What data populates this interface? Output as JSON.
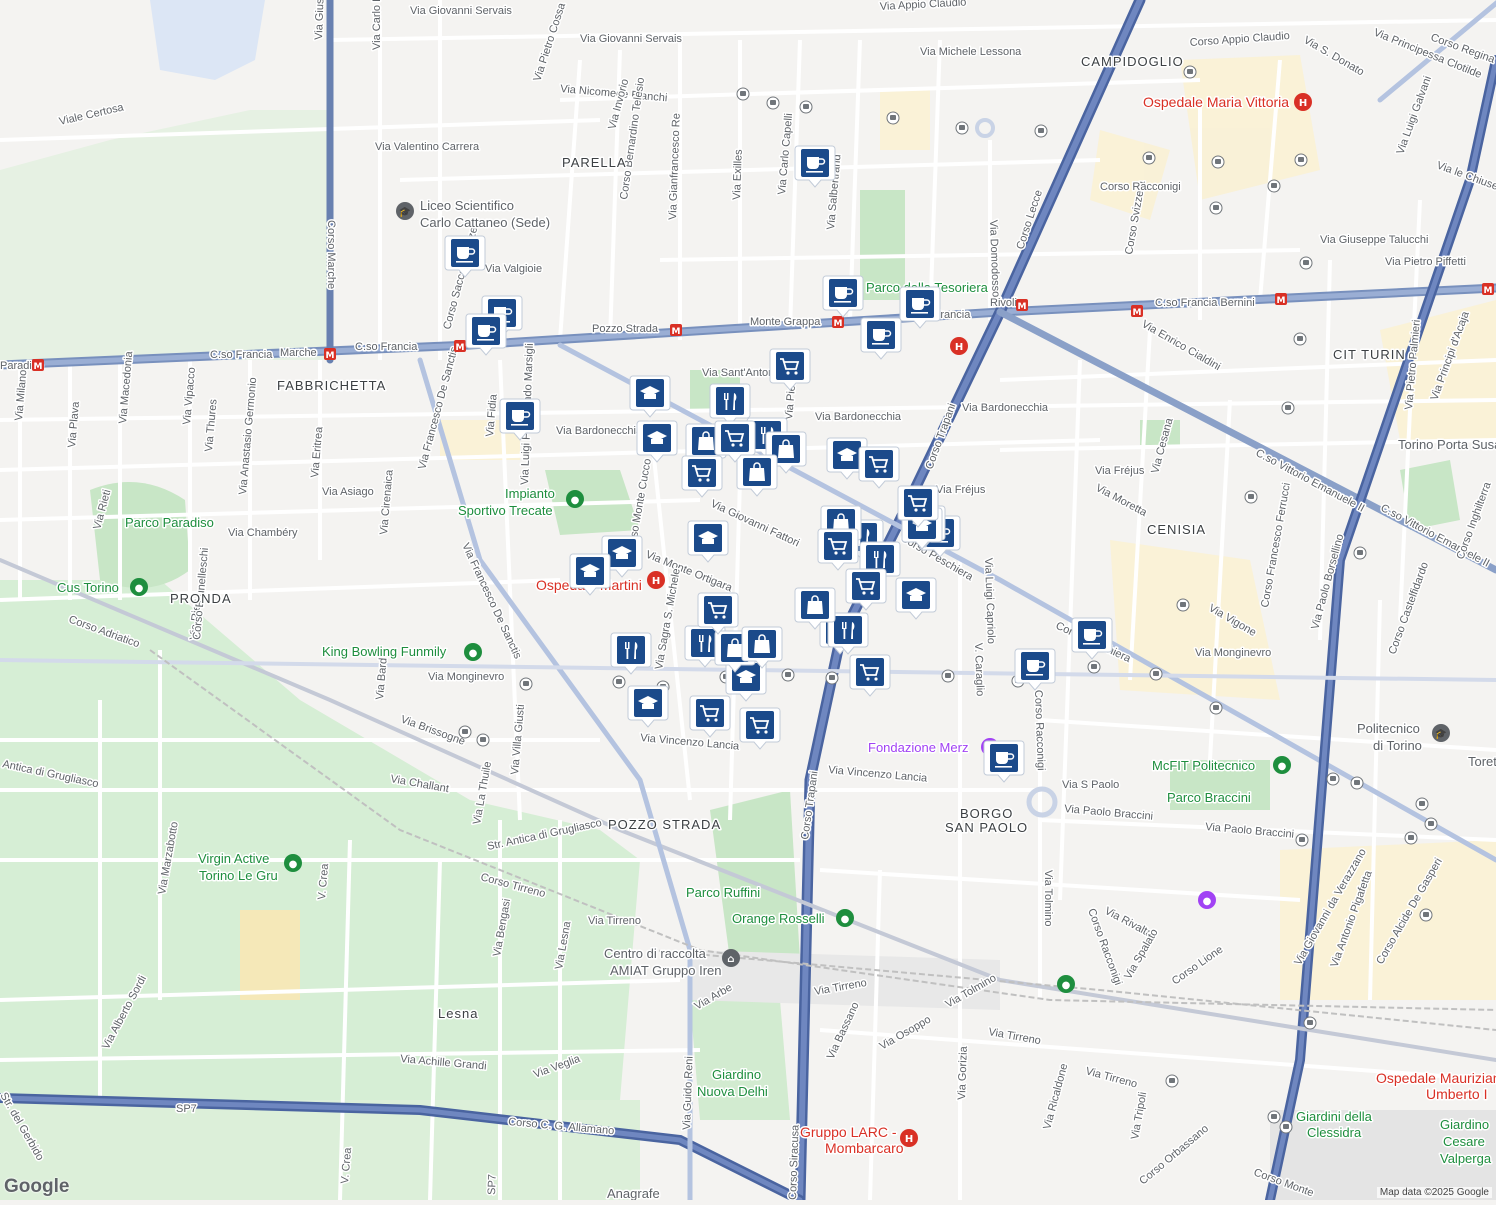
{
  "map": {
    "credit": "Map data ©2025 Google",
    "logo": "Google",
    "colors": {
      "background": "#f4f3f1",
      "park": "#cdeccf",
      "major_road": "#8aa0c8",
      "metro_road": "#3f5f99",
      "minor_road": "#ffffff",
      "marker": "#1b4a8a"
    },
    "areas": [
      {
        "id": "campidoglio",
        "text": "CAMPIDOGLIO"
      },
      {
        "id": "parella",
        "text": "PARELLA"
      },
      {
        "id": "fabbrichetta",
        "text": "FABBRICHETTA"
      },
      {
        "id": "cit-turin",
        "text": "CIT TURIN"
      },
      {
        "id": "cenisia",
        "text": "CENISIA"
      },
      {
        "id": "pronda",
        "text": "PRONDA"
      },
      {
        "id": "pozzo-strada",
        "text": "POZZO STRADA"
      },
      {
        "id": "borgo",
        "text": "BORGO"
      },
      {
        "id": "san-paolo",
        "text": "SAN PAOLO"
      },
      {
        "id": "lesna",
        "text": "Lesna"
      }
    ],
    "streets": [
      {
        "text": "Corso Appio Claudio"
      },
      {
        "text": "Via Appio Claudio"
      },
      {
        "text": "Via Giovanni Servais"
      },
      {
        "text": "Via Giovanni Servais"
      },
      {
        "text": "Via Michele Lessona"
      },
      {
        "text": "Via Nicomede Bianchi"
      },
      {
        "text": "Viale Certosa"
      },
      {
        "text": "Via Valentino Carrera"
      },
      {
        "text": "Via Pietro Cossa"
      },
      {
        "text": "Via Carlo Bianco"
      },
      {
        "text": "Via Invorio"
      },
      {
        "text": "Corso Bernardino Telesio"
      },
      {
        "text": "Via Gianfrancesco Re"
      },
      {
        "text": "Via Exilles"
      },
      {
        "text": "Via Carlo Capelli"
      },
      {
        "text": "Via Salbertrand"
      },
      {
        "text": "Via Domodossola"
      },
      {
        "text": "Corso Lecce"
      },
      {
        "text": "Corso Svizzera"
      },
      {
        "text": "Corso Marche"
      },
      {
        "text": "Via Valgioie"
      },
      {
        "text": "C.so Francia"
      },
      {
        "text": "C.so Francia"
      },
      {
        "text": "C.so Francia"
      },
      {
        "text": "C.so Francia Bernini"
      },
      {
        "text": "Pozzo Strada"
      },
      {
        "text": "Monte Grappa"
      },
      {
        "text": "Rivoli"
      },
      {
        "text": "Marche"
      },
      {
        "text": "Paradiso"
      },
      {
        "text": "Via Sant'Antonio"
      },
      {
        "text": "Via Bardonecchia"
      },
      {
        "text": "Via Bardonecchia"
      },
      {
        "text": "Via Bardonecchia"
      },
      {
        "text": "Via Asiago"
      },
      {
        "text": "Via Chambéry"
      },
      {
        "text": "Via Fréjus"
      },
      {
        "text": "Via Fréjus"
      },
      {
        "text": "Via Moretta"
      },
      {
        "text": "Via Giovanni Fattori"
      },
      {
        "text": "Via Monte Ortigara"
      },
      {
        "text": "Corso Peschiera"
      },
      {
        "text": "Corso Peschiera"
      },
      {
        "text": "Via Monginevro"
      },
      {
        "text": "Via Monginevro"
      },
      {
        "text": "Via Brissogne"
      },
      {
        "text": "Via Challant"
      },
      {
        "text": "Via Vincenzo Lancia"
      },
      {
        "text": "Via Vincenzo Lancia"
      },
      {
        "text": "Via Paolo Braccini"
      },
      {
        "text": "Via Paolo Braccini"
      },
      {
        "text": "Via S Paolo"
      },
      {
        "text": "Str. Antica di Grugliasco"
      },
      {
        "text": "Antica di Grugliasco"
      },
      {
        "text": "Corso Tirreno"
      },
      {
        "text": "Via Tirreno"
      },
      {
        "text": "Via Tirreno"
      },
      {
        "text": "Via Tirreno"
      },
      {
        "text": "Via Tirreno"
      },
      {
        "text": "Corso Adriatico"
      },
      {
        "text": "Corso C. G. Allamano"
      },
      {
        "text": "Via Achille Grandi"
      },
      {
        "text": "Via Veglia"
      },
      {
        "text": "Via Arbe"
      },
      {
        "text": "Via Bassano"
      },
      {
        "text": "Via Osoppo"
      },
      {
        "text": "Via Tolmino"
      },
      {
        "text": "Via Tolmino"
      },
      {
        "text": "Via Rivalta"
      },
      {
        "text": "Via Spalato"
      },
      {
        "text": "Corso Lione"
      },
      {
        "text": "Corso Racconigi"
      },
      {
        "text": "Corso Racconigi"
      },
      {
        "text": "Corso Francesco Ferrucci"
      },
      {
        "text": "Corso Castelfidardo"
      },
      {
        "text": "Corso Alcide De Gasperi"
      },
      {
        "text": "Via Giovanni da Verazzano"
      },
      {
        "text": "Via Antonio Pigafetta"
      },
      {
        "text": "Via Paolo Borsellino"
      },
      {
        "text": "Via Vigone"
      },
      {
        "text": "Via Cesana"
      },
      {
        "text": "C.so Vittorio Emanuele II"
      },
      {
        "text": "C.so Vittorio Emanuele II"
      },
      {
        "text": "Via Enrico Cialdini"
      },
      {
        "text": "Via Giuseppe Talucchi"
      },
      {
        "text": "Via Pietro Piffetti"
      },
      {
        "text": "Via Pietro Palmieri"
      },
      {
        "text": "Via Principi d'Acaja"
      },
      {
        "text": "Via Principessa Clotilde"
      },
      {
        "text": "Via S. Donato"
      },
      {
        "text": "Via Luigi Galvani"
      },
      {
        "text": "Via le Chiuse"
      },
      {
        "text": "Corso Regina"
      },
      {
        "text": "Corso Inghilterra"
      },
      {
        "text": "Corso Trapani"
      },
      {
        "text": "Corso Trapani"
      },
      {
        "text": "Corso Siracusa"
      },
      {
        "text": "Via Guido Reni"
      },
      {
        "text": "Via Francesco De Sanctis"
      },
      {
        "text": "Via Francesco De Sanctis"
      },
      {
        "text": "Via Sagra S. Michele"
      },
      {
        "text": "Via Luigi Capriolo"
      },
      {
        "text": "V. Caraglio"
      },
      {
        "text": "Corso Racconigi"
      },
      {
        "text": "Via Tripoli"
      },
      {
        "text": "Via Ricaldone"
      },
      {
        "text": "Via Gorizia"
      },
      {
        "text": "Corso Orbassano"
      },
      {
        "text": "Corso Monte"
      },
      {
        "text": "Via Marzabotto"
      },
      {
        "text": "Via Alberto Sordi"
      },
      {
        "text": "Str. del Gerbido"
      },
      {
        "text": "V. Crea"
      },
      {
        "text": "V. Crea"
      },
      {
        "text": "Via Bengasi"
      },
      {
        "text": "Via Lesna"
      },
      {
        "text": "Via La Thuile"
      },
      {
        "text": "Via Villa Giusti"
      },
      {
        "text": "Via Bard"
      },
      {
        "text": "Via Cirenaica"
      },
      {
        "text": "Via Eritrea"
      },
      {
        "text": "Via Fidia"
      },
      {
        "text": "Via Anastasio Germonio"
      },
      {
        "text": "Via Rieti"
      },
      {
        "text": "Via Vipacco"
      },
      {
        "text": "Via Thures"
      },
      {
        "text": "Via Macedonia"
      },
      {
        "text": "Via Plava"
      },
      {
        "text": "Via Milano"
      },
      {
        "text": "Via Rieti"
      },
      {
        "text": "Corso Brunelleschi"
      },
      {
        "text": "Via Luigi Ferdinando Marsigli"
      },
      {
        "text": "Corso Monte Cucco"
      },
      {
        "text": "Via Pietro"
      },
      {
        "text": "Corso Sacco e Vanzetti"
      },
      {
        "text": "Via Giuseppe Grosso"
      },
      {
        "text": "SP7"
      },
      {
        "text": "SP7"
      }
    ],
    "pois": [
      {
        "id": "ospedale-maria-vittoria",
        "text": "Ospedale Maria Vittoria",
        "kind": "hospital"
      },
      {
        "id": "liceo",
        "text": "Liceo Scientifico",
        "kind": "school"
      },
      {
        "id": "liceo2",
        "text": "Carlo Cattaneo (Sede)",
        "kind": "school"
      },
      {
        "id": "parco-tesoriera",
        "text": "Parco della Tesoriera",
        "kind": "park"
      },
      {
        "id": "impianto",
        "text": "Impianto",
        "kind": "sport"
      },
      {
        "id": "impianto2",
        "text": "Sportivo Trecate",
        "kind": "sport"
      },
      {
        "id": "parco-paradiso",
        "text": "Parco Paradiso",
        "kind": "park"
      },
      {
        "id": "cus-torino",
        "text": "Cus Torino",
        "kind": "sport"
      },
      {
        "id": "ospedale-martini",
        "text": "Ospedale Martini",
        "kind": "hospital"
      },
      {
        "id": "king-bowling",
        "text": "King Bowling Funmily",
        "kind": "sport"
      },
      {
        "id": "torino-porta-susa",
        "text": "Torino Porta Susa",
        "kind": "station"
      },
      {
        "id": "politecnico",
        "text": "Politecnico",
        "kind": "school"
      },
      {
        "id": "politecnico2",
        "text": "di Torino",
        "kind": "school"
      },
      {
        "id": "toret",
        "text": "Toret",
        "kind": "other"
      },
      {
        "id": "fondazione-merz",
        "text": "Fondazione Merz",
        "kind": "museum"
      },
      {
        "id": "mcfit",
        "text": "McFIT Politecnico",
        "kind": "sport"
      },
      {
        "id": "parco-braccini",
        "text": "Parco Braccini",
        "kind": "park"
      },
      {
        "id": "virgin-active",
        "text": "Virgin Active",
        "kind": "sport"
      },
      {
        "id": "virgin-active2",
        "text": "Torino Le Gru",
        "kind": "sport"
      },
      {
        "id": "parco-ruffini",
        "text": "Parco Ruffini",
        "kind": "park"
      },
      {
        "id": "orange-rosselli",
        "text": "Orange Rosselli",
        "kind": "sport"
      },
      {
        "id": "amiat",
        "text": "Centro di raccolta",
        "kind": "other"
      },
      {
        "id": "amiat2",
        "text": "AMIAT Gruppo Iren",
        "kind": "other"
      },
      {
        "id": "giardino-delhi",
        "text": "Giardino",
        "kind": "park"
      },
      {
        "id": "giardino-delhi2",
        "text": "Nuova Delhi",
        "kind": "park"
      },
      {
        "id": "gruppo-larc",
        "text": "Gruppo LARC -",
        "kind": "hospital"
      },
      {
        "id": "gruppo-larc2",
        "text": "Mombarcaro",
        "kind": "hospital"
      },
      {
        "id": "ospedale-mauriziano",
        "text": "Ospedale Mauriziano",
        "kind": "hospital"
      },
      {
        "id": "ospedale-mauriziano2",
        "text": "Umberto I",
        "kind": "hospital"
      },
      {
        "id": "giardini-clessidra",
        "text": "Giardini della",
        "kind": "park"
      },
      {
        "id": "giardini-clessidra2",
        "text": "Clessidra",
        "kind": "park"
      },
      {
        "id": "giardino-cesare",
        "text": "Giardino",
        "kind": "park"
      },
      {
        "id": "giardino-cesare2",
        "text": "Cesare",
        "kind": "park"
      },
      {
        "id": "giardino-cesare3",
        "text": "Valperga",
        "kind": "park"
      },
      {
        "id": "anagrafe",
        "text": "Anagrafe",
        "kind": "other"
      }
    ],
    "markers": [
      {
        "kind": "cafe"
      },
      {
        "kind": "cafe"
      },
      {
        "kind": "cafe"
      },
      {
        "kind": "cafe"
      },
      {
        "kind": "cafe"
      },
      {
        "kind": "cafe"
      },
      {
        "kind": "cafe"
      },
      {
        "kind": "cafe"
      },
      {
        "kind": "cafe"
      },
      {
        "kind": "cafe"
      },
      {
        "kind": "cafe"
      },
      {
        "kind": "cafe"
      },
      {
        "kind": "cafe"
      },
      {
        "kind": "school"
      },
      {
        "kind": "school"
      },
      {
        "kind": "school"
      },
      {
        "kind": "school"
      },
      {
        "kind": "school"
      },
      {
        "kind": "school"
      },
      {
        "kind": "school"
      },
      {
        "kind": "school"
      },
      {
        "kind": "school"
      },
      {
        "kind": "school"
      },
      {
        "kind": "restaurant"
      },
      {
        "kind": "restaurant"
      },
      {
        "kind": "restaurant"
      },
      {
        "kind": "restaurant"
      },
      {
        "kind": "restaurant"
      },
      {
        "kind": "restaurant"
      },
      {
        "kind": "restaurant"
      },
      {
        "kind": "restaurant"
      },
      {
        "kind": "shopping"
      },
      {
        "kind": "shopping"
      },
      {
        "kind": "shopping"
      },
      {
        "kind": "shopping"
      },
      {
        "kind": "shopping"
      },
      {
        "kind": "shopping"
      },
      {
        "kind": "shopping"
      },
      {
        "kind": "grocery"
      },
      {
        "kind": "grocery"
      },
      {
        "kind": "grocery"
      },
      {
        "kind": "grocery"
      },
      {
        "kind": "grocery"
      },
      {
        "kind": "grocery"
      },
      {
        "kind": "grocery"
      },
      {
        "kind": "grocery"
      },
      {
        "kind": "grocery"
      },
      {
        "kind": "grocery"
      },
      {
        "kind": "grocery"
      }
    ]
  }
}
